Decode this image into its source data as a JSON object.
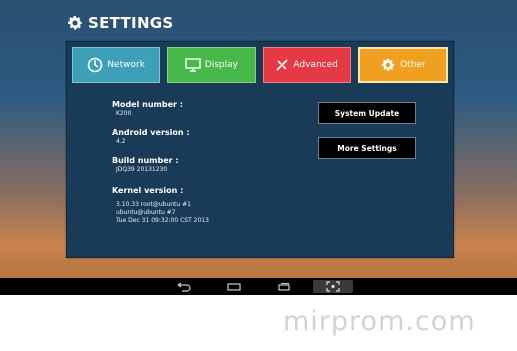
{
  "header": {
    "title": "SETTINGS",
    "icon": "gear-icon"
  },
  "tabs": [
    {
      "label": "Network",
      "icon": "network-icon",
      "color": "#3ea0b8"
    },
    {
      "label": "Display",
      "icon": "display-icon",
      "color": "#48b84a"
    },
    {
      "label": "Advanced",
      "icon": "advanced-icon",
      "color": "#e53a46"
    },
    {
      "label": "Other",
      "icon": "gear-icon",
      "color": "#f0a020",
      "selected": true
    }
  ],
  "info": {
    "model_label": "Model number :",
    "model_value": "K200",
    "android_label": "Android version :",
    "android_value": "4.2",
    "build_label": "Build number :",
    "build_value": "JDQ39 20131230",
    "kernel_label": "Kernel version :",
    "kernel_line1": "3.10.33 root@ubuntu #1",
    "kernel_line2": "ubuntu@ubuntu #7",
    "kernel_line3": "Tue Dec 31 09:32:00 CST 2013"
  },
  "buttons": {
    "system_update": "System Update",
    "more_settings": "More Settings"
  },
  "navbar": [
    "back-icon",
    "home-icon",
    "recent-apps-icon",
    "screenshot-icon"
  ],
  "watermark": "mirprom.com"
}
